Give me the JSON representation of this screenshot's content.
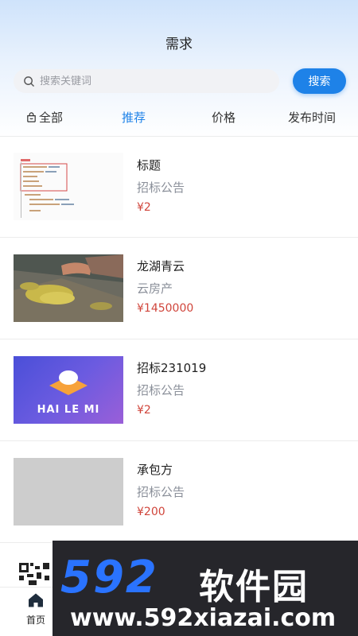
{
  "header": {
    "title": "需求"
  },
  "search": {
    "placeholder": "搜索关键词",
    "button_label": "搜索"
  },
  "tabs": [
    {
      "label": "全部",
      "icon": "bag-icon"
    },
    {
      "label": "推荐",
      "active": true
    },
    {
      "label": "价格"
    },
    {
      "label": "发布时间"
    }
  ],
  "items": [
    {
      "title": "标题",
      "subtitle": "招标公告",
      "price": "¥2",
      "thumb": "code-screenshot"
    },
    {
      "title": "龙湖青云",
      "subtitle": "云房产",
      "price": "¥1450000",
      "thumb": "photo-leaves"
    },
    {
      "title": "招标231019",
      "subtitle": "招标公告",
      "price": "¥2",
      "thumb": "logo",
      "thumb_text": "HAI LE MI"
    },
    {
      "title": "承包方",
      "subtitle": "招标公告",
      "price": "¥200",
      "thumb": "placeholder-gray"
    }
  ],
  "tabbar": {
    "home_label": "首页"
  },
  "watermark": {
    "brand": "592",
    "name": "软件园",
    "url": "www.592xiazai.com"
  },
  "colors": {
    "accent": "#1e82e8",
    "price": "#d0453b",
    "muted": "#8a8f99"
  }
}
